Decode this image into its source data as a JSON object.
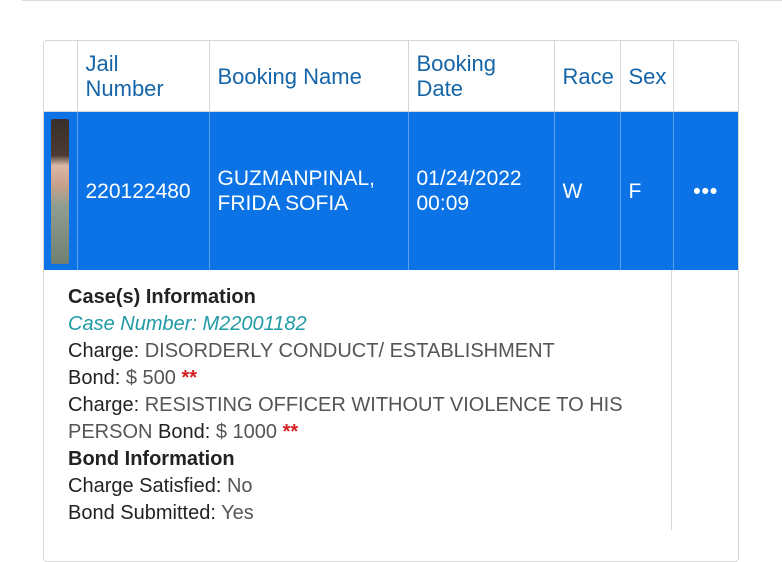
{
  "table": {
    "headers": {
      "jail_number": "Jail\nNumber",
      "booking_name": "Booking Name",
      "booking_date": "Booking\nDate",
      "race": "Race",
      "sex": "Sex"
    },
    "row": {
      "jail_number": "220122480",
      "booking_name": "GUZMANPINAL, FRIDA SOFIA",
      "booking_date": "01/24/2022 00:09",
      "race": "W",
      "sex": "F",
      "more": "•••"
    }
  },
  "details": {
    "case_header": "Case(s) Information",
    "case_number_label": "Case Number:",
    "case_number": "M22001182",
    "charges": [
      {
        "charge_label": "Charge:",
        "charge": "DISORDERLY CONDUCT/ ESTABLISHMENT",
        "bond_label": "Bond:",
        "bond": "$ 500",
        "flag": "**"
      },
      {
        "charge_label": "Charge:",
        "charge": "RESISTING OFFICER WITHOUT VIOLENCE TO HIS PERSON",
        "bond_label": "Bond:",
        "bond": "$ 1000",
        "flag": "**"
      }
    ],
    "bond_header": "Bond Information",
    "charge_satisfied_label": "Charge Satisfied:",
    "charge_satisfied": "No",
    "bond_submitted_label": "Bond Submitted:",
    "bond_submitted": "Yes"
  },
  "colors": {
    "selected_row": "#0b73e6",
    "header_text": "#1565a8",
    "case_link": "#1f9aa6",
    "flag": "#d42020"
  }
}
